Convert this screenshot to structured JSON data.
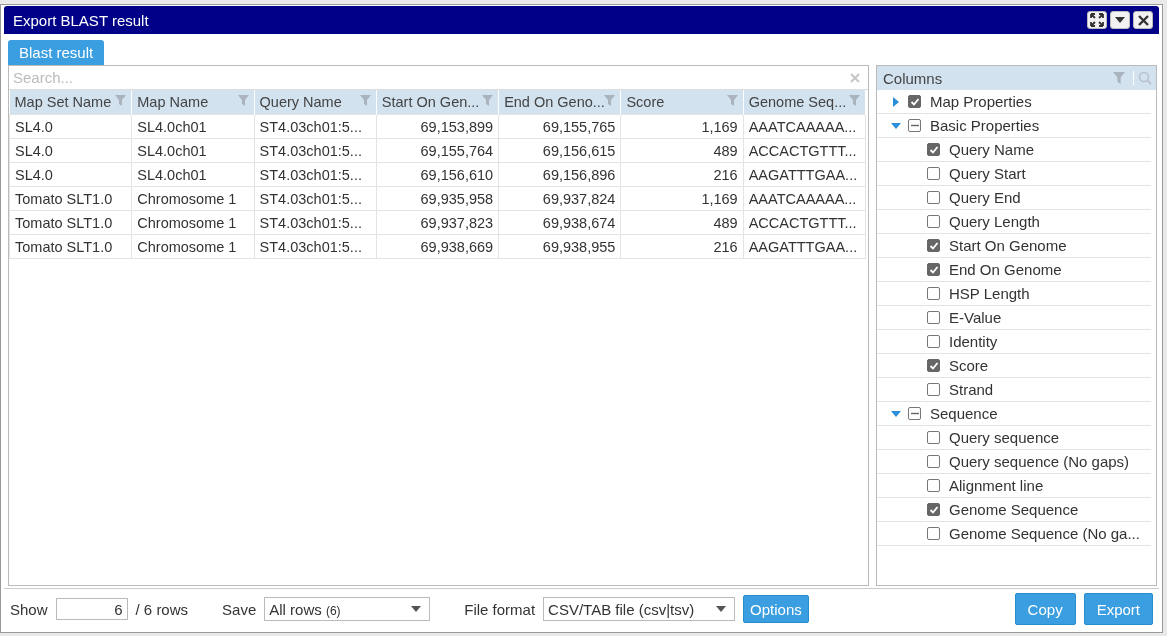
{
  "window": {
    "title": "Export BLAST result"
  },
  "tabs": [
    {
      "label": "Blast result",
      "selected": true
    }
  ],
  "search": {
    "placeholder": "Search..."
  },
  "table": {
    "columns": [
      {
        "label": "Map Set Name",
        "kind": "text"
      },
      {
        "label": "Map Name",
        "kind": "text"
      },
      {
        "label": "Query Name",
        "kind": "text"
      },
      {
        "label": "Start On Gen...",
        "kind": "number"
      },
      {
        "label": "End On Geno...",
        "kind": "number"
      },
      {
        "label": "Score",
        "kind": "number"
      },
      {
        "label": "Genome Seq...",
        "kind": "text"
      }
    ],
    "rows": [
      [
        "SL4.0",
        "SL4.0ch01",
        "ST4.03ch01:5...",
        "69,153,899",
        "69,155,765",
        "1,169",
        "AAATCAAAAA..."
      ],
      [
        "SL4.0",
        "SL4.0ch01",
        "ST4.03ch01:5...",
        "69,155,764",
        "69,156,615",
        "489",
        "ACCACTGTTT..."
      ],
      [
        "SL4.0",
        "SL4.0ch01",
        "ST4.03ch01:5...",
        "69,156,610",
        "69,156,896",
        "216",
        "AAGATTTGAA..."
      ],
      [
        "Tomato SLT1.0",
        "Chromosome 1",
        "ST4.03ch01:5...",
        "69,935,958",
        "69,937,824",
        "1,169",
        "AAATCAAAAA..."
      ],
      [
        "Tomato SLT1.0",
        "Chromosome 1",
        "ST4.03ch01:5...",
        "69,937,823",
        "69,938,674",
        "489",
        "ACCACTGTTT..."
      ],
      [
        "Tomato SLT1.0",
        "Chromosome 1",
        "ST4.03ch01:5...",
        "69,938,669",
        "69,938,955",
        "216",
        "AAGATTTGAA..."
      ]
    ]
  },
  "columns_panel": {
    "title": "Columns",
    "groups": [
      {
        "label": "Map Properties",
        "expanded": false,
        "checked": true
      },
      {
        "label": "Basic Properties",
        "expanded": true,
        "indeterminate": true,
        "children": [
          {
            "label": "Query Name",
            "checked": true
          },
          {
            "label": "Query Start",
            "checked": false
          },
          {
            "label": "Query End",
            "checked": false
          },
          {
            "label": "Query Length",
            "checked": false
          },
          {
            "label": "Start On Genome",
            "checked": true
          },
          {
            "label": "End On Genome",
            "checked": true
          },
          {
            "label": "HSP Length",
            "checked": false
          },
          {
            "label": "E-Value",
            "checked": false
          },
          {
            "label": "Identity",
            "checked": false
          },
          {
            "label": "Score",
            "checked": true
          },
          {
            "label": "Strand",
            "checked": false
          }
        ]
      },
      {
        "label": "Sequence",
        "expanded": true,
        "indeterminate": true,
        "children": [
          {
            "label": "Query sequence",
            "checked": false
          },
          {
            "label": "Query sequence (No gaps)",
            "checked": false
          },
          {
            "label": "Alignment line",
            "checked": false
          },
          {
            "label": "Genome Sequence",
            "checked": true
          },
          {
            "label": "Genome Sequence (No ga...",
            "checked": false
          }
        ]
      }
    ]
  },
  "footer": {
    "show_label": "Show",
    "show_value": "6",
    "rows_label": "/ 6 rows",
    "save_label": "Save",
    "save_value": "All rows",
    "save_count": "(6)",
    "format_label": "File format",
    "format_value": "CSV/TAB file (csv|tsv)",
    "options_button": "Options",
    "buttons": [
      "Copy",
      "Export"
    ]
  }
}
